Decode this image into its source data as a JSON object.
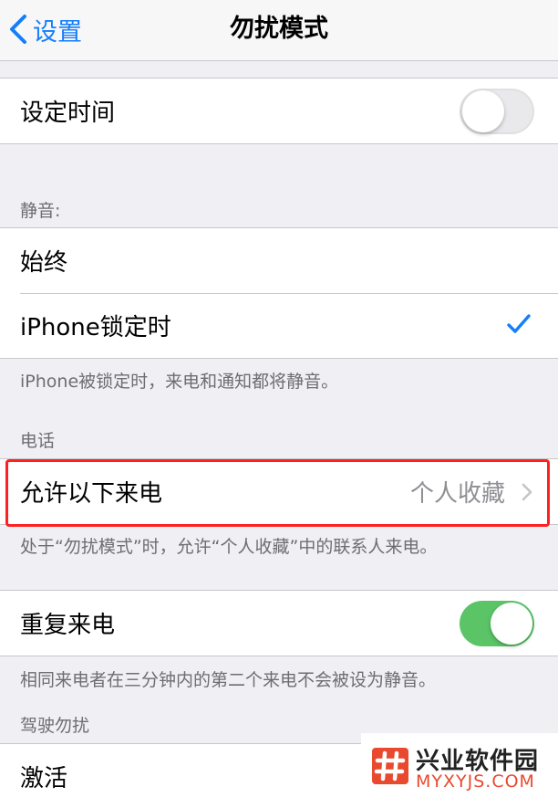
{
  "navbar": {
    "back_label": "设置",
    "title": "勿扰模式"
  },
  "schedule": {
    "label": "设定时间",
    "toggle_on": false
  },
  "silence": {
    "header": "静音:",
    "options": [
      {
        "label": "始终",
        "selected": false
      },
      {
        "label": "iPhone锁定时",
        "selected": true
      }
    ],
    "footer": "iPhone被锁定时，来电和通知都将静音。"
  },
  "phone": {
    "header": "电话",
    "allow_calls": {
      "label": "允许以下来电",
      "value": "个人收藏"
    },
    "footer": "处于“勿扰模式”时，允许“个人收藏”中的联系人来电。"
  },
  "repeated_calls": {
    "label": "重复来电",
    "toggle_on": true,
    "footer": "相同来电者在三分钟内的第二个来电不会被设为静音。"
  },
  "driving": {
    "header": "驾驶勿扰",
    "activate_label": "激活"
  },
  "watermark": {
    "name": "兴业软件园",
    "url": "MYXYJS.COM"
  },
  "colors": {
    "accent": "#147efb",
    "toggle_on": "#5ac466",
    "highlight": "#ff2020",
    "background": "#efeff4"
  },
  "icons": {
    "back": "chevron-left-icon",
    "check": "checkmark-icon",
    "disclosure": "chevron-right-icon",
    "logo": "hash-logo-icon"
  }
}
